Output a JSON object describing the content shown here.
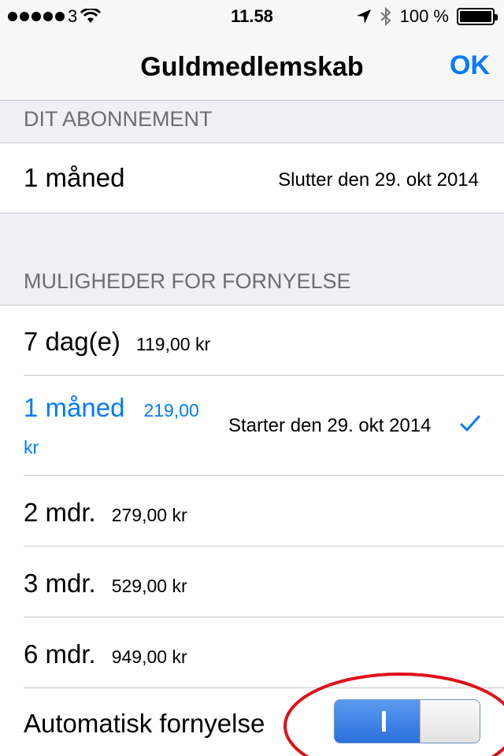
{
  "status_bar": {
    "carrier": "3",
    "time": "11.58",
    "battery": "100 %"
  },
  "nav": {
    "title": "Guldmedlemskab",
    "ok_label": "OK"
  },
  "subscription": {
    "header": "DIT ABONNEMENT",
    "period": "1 måned",
    "ends": "Slutter den 29. okt 2014"
  },
  "renewal": {
    "header": "MULIGHEDER FOR FORNYELSE",
    "options": [
      {
        "label": "7 dag(e)",
        "price": "119,00 kr"
      },
      {
        "label": "1 måned",
        "price": "219,00",
        "price_wrap": "kr",
        "start": "Starter den 29. okt 2014",
        "selected": true
      },
      {
        "label": "2 mdr.",
        "price": "279,00 kr"
      },
      {
        "label": "3 mdr.",
        "price": "529,00 kr"
      },
      {
        "label": "6 mdr.",
        "price": "949,00 kr"
      }
    ]
  },
  "auto_renew": {
    "label": "Automatisk fornyelse",
    "enabled": true
  },
  "colors": {
    "accent": "#007aff",
    "annotation": "#e0101a"
  }
}
